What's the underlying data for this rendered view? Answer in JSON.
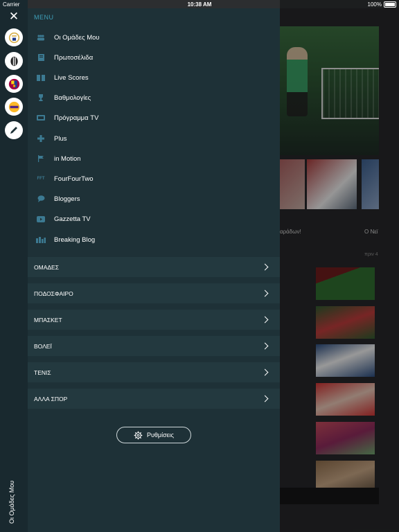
{
  "status": {
    "carrier": "Carrier",
    "time": "10:38 AM",
    "battery": "100%"
  },
  "background": {
    "caption_left": "αράδων!",
    "caption_right": "Ο Νεϊ",
    "time_ago": "πριν 4"
  },
  "rail": {
    "teams": [
      {
        "name": "real-madrid",
        "color": "#d8b04a"
      },
      {
        "name": "juventus",
        "color": "#222222"
      },
      {
        "name": "barcelona",
        "color": "#a50044"
      },
      {
        "name": "lakers",
        "color": "#552583"
      }
    ],
    "vertical_label": "Οι Ομάδες Μου"
  },
  "menu": {
    "heading": "MENU",
    "items": [
      {
        "label": "Οι Ομάδες Μου",
        "icon": "people-icon"
      },
      {
        "label": "Πρωτοσέλιδα",
        "icon": "newspaper-icon"
      },
      {
        "label": "Live Scores",
        "icon": "scoreboard-icon"
      },
      {
        "label": "Βαθμολογίες",
        "icon": "trophy-icon"
      },
      {
        "label": "Πρόγραμμα TV",
        "icon": "tv-icon"
      },
      {
        "label": "Plus",
        "icon": "plus-icon"
      },
      {
        "label": "in Motion",
        "icon": "motion-flag-icon"
      },
      {
        "label": "FourFourTwo",
        "icon": "fft-icon",
        "icon_text": "FFT"
      },
      {
        "label": "Bloggers",
        "icon": "chat-icon"
      },
      {
        "label": "Gazzetta TV",
        "icon": "play-icon"
      },
      {
        "label": "Breaking Blog",
        "icon": "blog-icon"
      }
    ]
  },
  "sections": [
    {
      "label": "ΟΜΑΔΕΣ"
    },
    {
      "label": "ΠΟΔΟΣΦΑΙΡΟ"
    },
    {
      "label": "ΜΠΑΣΚΕΤ"
    },
    {
      "label": "ΒΟΛΕΪ"
    },
    {
      "label": "ΤΕΝΙΣ"
    },
    {
      "label": "ΑΛΛΑ ΣΠΟΡ"
    }
  ],
  "settings": {
    "label": "Ρυθμίσεις"
  },
  "colors": {
    "accent": "#3f9fb9",
    "panel": "#1e3137",
    "rail": "#19292f",
    "section": "#23393f"
  }
}
